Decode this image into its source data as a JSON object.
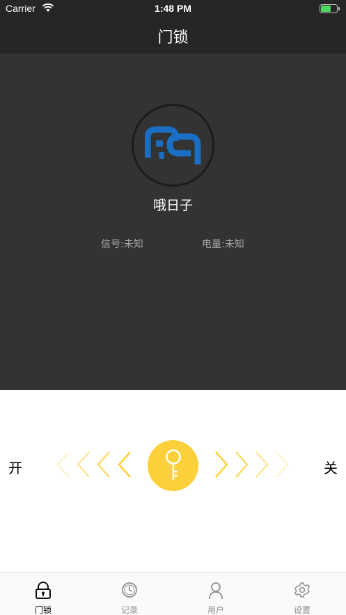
{
  "status_bar": {
    "carrier": "Carrier",
    "time": "1:48 PM"
  },
  "nav": {
    "title": "门锁"
  },
  "device": {
    "name": "哦日子",
    "signal": "信号:未知",
    "battery": "电量:未知"
  },
  "lock": {
    "open_label": "开",
    "close_label": "关"
  },
  "tabs": [
    {
      "label": "门锁",
      "icon": "lock-icon",
      "active": true
    },
    {
      "label": "记录",
      "icon": "clock-icon",
      "active": false
    },
    {
      "label": "用户",
      "icon": "user-icon",
      "active": false
    },
    {
      "label": "设置",
      "icon": "gear-icon",
      "active": false
    }
  ],
  "colors": {
    "accent": "#fcd03a",
    "logo": "#1a6fc4",
    "header": "#262626",
    "panel": "#333333"
  }
}
